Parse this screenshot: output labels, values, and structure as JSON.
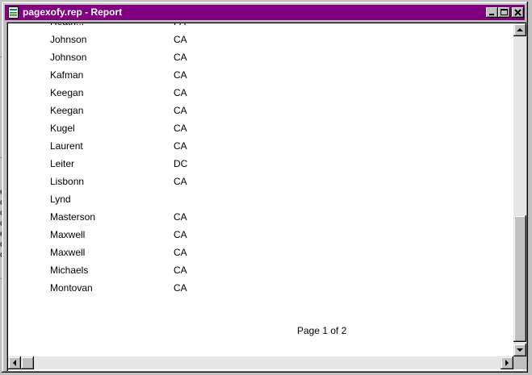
{
  "window": {
    "title": "pagexofy.rep - Report"
  },
  "background": {
    "left_fragments": [
      "e",
      "c",
      "c",
      "c",
      "e",
      "o",
      "c"
    ]
  },
  "report": {
    "partial_top_row": {
      "name": "Heath...",
      "state": "PA"
    },
    "rows": [
      {
        "name": "Johnson",
        "state": "CA"
      },
      {
        "name": "Johnson",
        "state": "CA"
      },
      {
        "name": "Kafman",
        "state": "CA"
      },
      {
        "name": "Keegan",
        "state": "CA"
      },
      {
        "name": "Keegan",
        "state": "CA"
      },
      {
        "name": "Kugel",
        "state": "CA"
      },
      {
        "name": "Laurent",
        "state": "CA"
      },
      {
        "name": "Leiter",
        "state": "DC"
      },
      {
        "name": "Lisbonn",
        "state": "CA"
      },
      {
        "name": "Lynd",
        "state": ""
      },
      {
        "name": "Masterson",
        "state": "CA"
      },
      {
        "name": "Maxwell",
        "state": "CA"
      },
      {
        "name": "Maxwell",
        "state": "CA"
      },
      {
        "name": "Michaels",
        "state": "CA"
      },
      {
        "name": "Montovan",
        "state": "CA"
      }
    ],
    "page_label": "Page 1 of 2"
  },
  "icons": {
    "title_icon": "report-document-icon",
    "minimize": "minimize-icon",
    "maximize": "maximize-icon",
    "close": "close-icon",
    "scroll_up": "arrow-up-icon",
    "scroll_down": "arrow-down-icon",
    "scroll_left": "arrow-left-icon",
    "scroll_right": "arrow-right-icon"
  },
  "colors": {
    "titlebar": "#800080",
    "face": "#c0c0c0"
  }
}
